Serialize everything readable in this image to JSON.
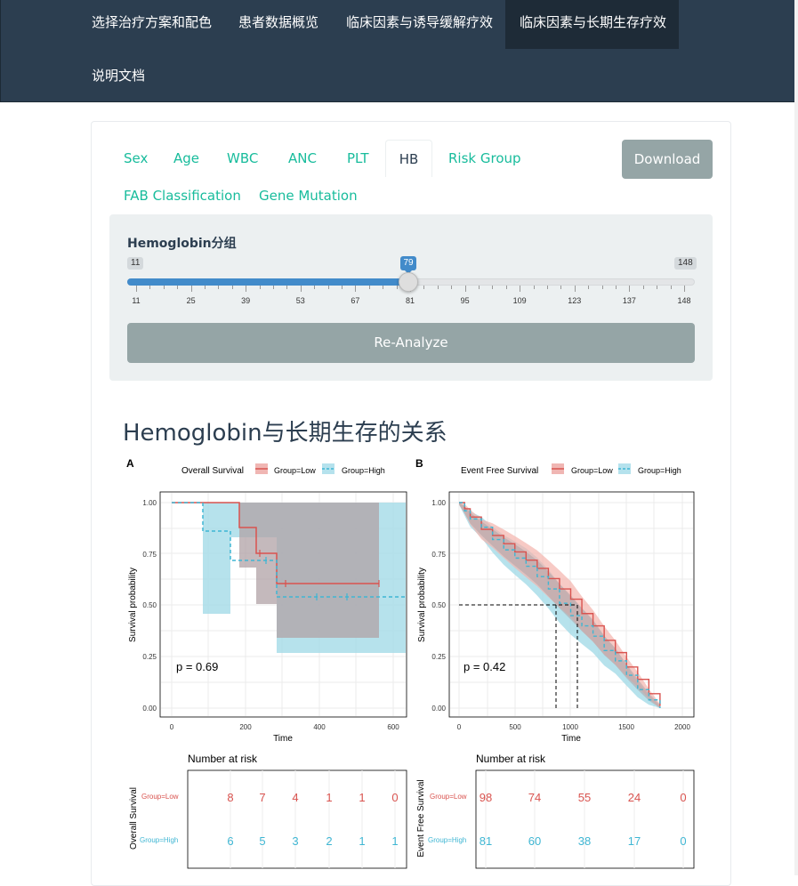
{
  "navbar": {
    "items": [
      {
        "label": "选择治疗方案和配色",
        "active": false
      },
      {
        "label": "患者数据概览",
        "active": false
      },
      {
        "label": "临床因素与诱导缓解疗效",
        "active": false
      },
      {
        "label": "临床因素与长期生存疗效",
        "active": true
      },
      {
        "label": "说明文档",
        "active": false
      }
    ]
  },
  "tabs": {
    "items": [
      "Sex",
      "Age",
      "WBC",
      "ANC",
      "PLT",
      "HB",
      "Risk Group",
      "FAB Classification",
      "Gene Mutation"
    ],
    "active": "HB"
  },
  "download_label": "Download",
  "slider": {
    "label": "Hemoglobin分组",
    "min": "11",
    "max": "148",
    "value": "79",
    "value_fraction": 0.4964,
    "ticks": [
      "11",
      "25",
      "39",
      "53",
      "67",
      "81",
      "95",
      "109",
      "123",
      "137",
      "148"
    ]
  },
  "reanalyze_label": "Re-Analyze",
  "section_title": "Hemoglobin与长期生存的关系",
  "colors": {
    "low": "#d9534f",
    "high": "#3fb6d3",
    "accent": "#18bc9c",
    "navbar": "#2c3e50",
    "slider": "#428bca"
  },
  "panel_a": {
    "letter": "A",
    "legend_title": "Overall Survival",
    "legend_low": "Group=Low",
    "legend_high": "Group=High",
    "ylabel": "Survival probability",
    "xlabel": "Time",
    "pvalue": "p = 0.69",
    "y_ticks": [
      "1.00",
      "0.75",
      "0.50",
      "0.25",
      "0.00"
    ],
    "x_ticks": [
      "0",
      "200",
      "400",
      "600"
    ],
    "risk_title": "Number at risk",
    "risk_ylabel": "Overall Survival",
    "risk_low_label": "Group=Low",
    "risk_high_label": "Group=High",
    "risk_low": [
      "8",
      "7",
      "4",
      "1",
      "1",
      "0"
    ],
    "risk_high": [
      "6",
      "5",
      "3",
      "2",
      "1",
      "1"
    ]
  },
  "panel_b": {
    "letter": "B",
    "legend_title": "Event Free Survival",
    "legend_low": "Group=Low",
    "legend_high": "Group=High",
    "ylabel": "Survival probability",
    "xlabel": "Time",
    "pvalue": "p = 0.42",
    "y_ticks": [
      "1.00",
      "0.75",
      "0.50",
      "0.25",
      "0.00"
    ],
    "x_ticks": [
      "0",
      "500",
      "1000",
      "1500",
      "2000"
    ],
    "risk_title": "Number at risk",
    "risk_ylabel": "Event Free Survival",
    "risk_low_label": "Group=Low",
    "risk_high_label": "Group=High",
    "risk_low": [
      "98",
      "74",
      "55",
      "24",
      "0"
    ],
    "risk_high": [
      "81",
      "60",
      "38",
      "17",
      "0"
    ]
  },
  "chart_data": [
    {
      "type": "line",
      "title": "Overall Survival",
      "xlabel": "Time",
      "ylabel": "Survival probability",
      "xlim": [
        0,
        630
      ],
      "ylim": [
        0,
        1
      ],
      "series": [
        {
          "name": "Group=Low",
          "x": [
            0,
            180,
            180,
            230,
            230,
            280,
            280,
            560
          ],
          "y": [
            1,
            1,
            0.875,
            0.875,
            0.75,
            0.75,
            0.6,
            0.6
          ]
        },
        {
          "name": "Group=High",
          "x": [
            0,
            85,
            85,
            160,
            160,
            280,
            280,
            630
          ],
          "y": [
            1,
            1,
            0.857,
            0.857,
            0.714,
            0.714,
            0.536,
            0.536
          ]
        }
      ],
      "annotations": [
        "p = 0.69"
      ]
    },
    {
      "type": "line",
      "title": "Event Free Survival",
      "xlabel": "Time",
      "ylabel": "Survival probability",
      "xlim": [
        0,
        2000
      ],
      "ylim": [
        0,
        1
      ],
      "series": [
        {
          "name": "Group=Low",
          "x": [
            0,
            50,
            100,
            200,
            300,
            400,
            500,
            600,
            700,
            800,
            900,
            1000,
            1100,
            1200,
            1300,
            1400,
            1500,
            1600,
            1700,
            1800
          ],
          "y": [
            1,
            0.97,
            0.93,
            0.87,
            0.84,
            0.8,
            0.76,
            0.72,
            0.68,
            0.63,
            0.58,
            0.53,
            0.46,
            0.4,
            0.33,
            0.27,
            0.2,
            0.14,
            0.07,
            0.01
          ]
        },
        {
          "name": "Group=High",
          "x": [
            0,
            50,
            100,
            200,
            300,
            400,
            500,
            600,
            700,
            800,
            900,
            1000,
            1100,
            1200,
            1300,
            1400,
            1500,
            1600,
            1700,
            1800
          ],
          "y": [
            1,
            0.96,
            0.92,
            0.88,
            0.82,
            0.77,
            0.73,
            0.69,
            0.64,
            0.58,
            0.51,
            0.45,
            0.4,
            0.35,
            0.28,
            0.23,
            0.16,
            0.09,
            0.04,
            0.0
          ]
        }
      ],
      "annotations": [
        "p = 0.42"
      ]
    }
  ]
}
